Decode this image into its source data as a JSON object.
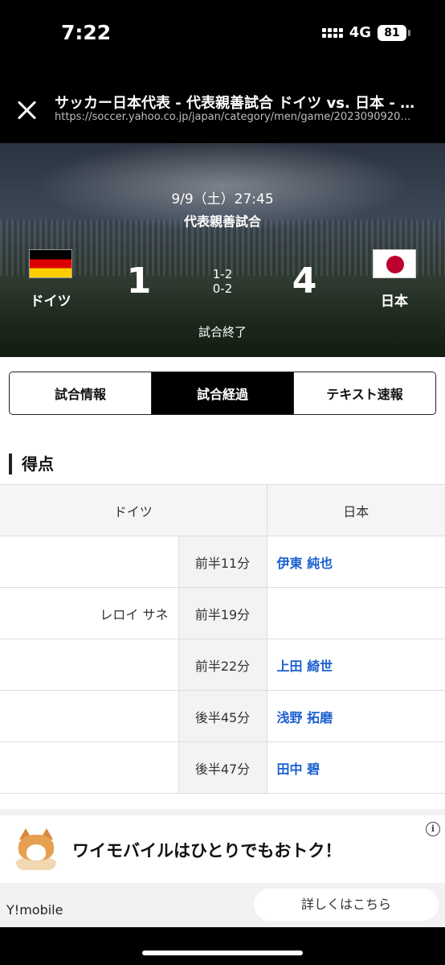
{
  "status_bar": {
    "time": "7:22",
    "network": "4G",
    "battery": "81"
  },
  "browser": {
    "title": "サッカー日本代表 - 代表親善試合 ドイツ vs. 日本 - スポーツナビ",
    "url": "https://soccer.yahoo.co.jp/japan/category/men/game/2023090920…"
  },
  "match": {
    "date": "9/9（土）27:45",
    "competition": "代表親善試合",
    "home": {
      "name": "ドイツ",
      "score": "1",
      "flag": "germany-flag-icon"
    },
    "away": {
      "name": "日本",
      "score": "4",
      "flag": "japan-flag-icon"
    },
    "first_half": "1-2",
    "second_half": "0-2",
    "status": "試合終了"
  },
  "tabs": [
    {
      "label": "試合情報",
      "active": false
    },
    {
      "label": "試合経過",
      "active": true
    },
    {
      "label": "テキスト速報",
      "active": false
    }
  ],
  "goals": {
    "title": "得点",
    "headers": {
      "home": "ドイツ",
      "away": "日本"
    },
    "rows": [
      {
        "home": "",
        "minute": "前半11分",
        "away": "伊東 純也"
      },
      {
        "home": "レロイ サネ",
        "minute": "前半19分",
        "away": ""
      },
      {
        "home": "",
        "minute": "前半22分",
        "away": "上田 綺世"
      },
      {
        "home": "",
        "minute": "後半45分",
        "away": "浅野 拓磨"
      },
      {
        "home": "",
        "minute": "後半47分",
        "away": "田中 碧"
      }
    ]
  },
  "ad": {
    "text": "ワイモバイルはひとりでもおトク！",
    "brand": "Y!mobile",
    "cta": "詳しくはこちら",
    "info_glyph": "i"
  },
  "colors": {
    "link": "#1a5fd0",
    "active_tab": "#000000",
    "minute_bg": "#f3f3f3"
  }
}
